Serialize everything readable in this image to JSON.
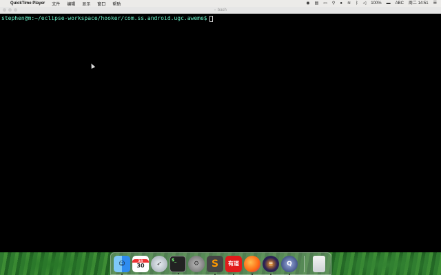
{
  "menubar": {
    "app_name": "QuickTime Player",
    "menus": [
      "文件",
      "编辑",
      "显示",
      "窗口",
      "帮助"
    ],
    "status": {
      "battery": "100%",
      "input_source": "ABC",
      "datetime": "周二 14:51"
    }
  },
  "terminal": {
    "title": "bash",
    "prompt": "stephen@m:~/eclipse-workspace/hooker/com.ss.android.ugc.aweme$"
  },
  "dock": {
    "calendar_month": "2月",
    "calendar_day": "30"
  },
  "icons": {
    "apple": "apple-icon",
    "dock": [
      "finder-icon",
      "calendar-icon",
      "launchpad-icon",
      "terminal-icon",
      "system-preferences-icon",
      "sublime-text-icon",
      "youdao-icon",
      "firefox-icon",
      "eclipse-icon",
      "quicktime-icon",
      "trash-icon"
    ]
  },
  "colors": {
    "terminal_bg": "#000000",
    "prompt_text": "#5cf2c8",
    "menubar_bg": "#ecebe9"
  }
}
